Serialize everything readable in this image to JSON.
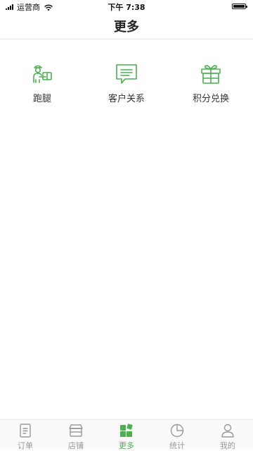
{
  "status_bar": {
    "carrier": "运营商",
    "time": "下午 7:38"
  },
  "nav": {
    "title": "更多"
  },
  "grid": {
    "items": [
      {
        "label": "跑腿",
        "icon": "courier-icon"
      },
      {
        "label": "客户关系",
        "icon": "message-icon"
      },
      {
        "label": "积分兑换",
        "icon": "gift-icon"
      }
    ]
  },
  "tab_bar": {
    "active_index": 2,
    "tabs": [
      {
        "label": "订单",
        "icon": "document-icon"
      },
      {
        "label": "店铺",
        "icon": "store-icon"
      },
      {
        "label": "更多",
        "icon": "grid-icon"
      },
      {
        "label": "统计",
        "icon": "pie-chart-icon"
      },
      {
        "label": "我的",
        "icon": "user-icon"
      }
    ]
  },
  "colors": {
    "accent": "#4caf50",
    "inactive": "#999999",
    "text": "#333333",
    "divider": "#e6e6e6"
  }
}
